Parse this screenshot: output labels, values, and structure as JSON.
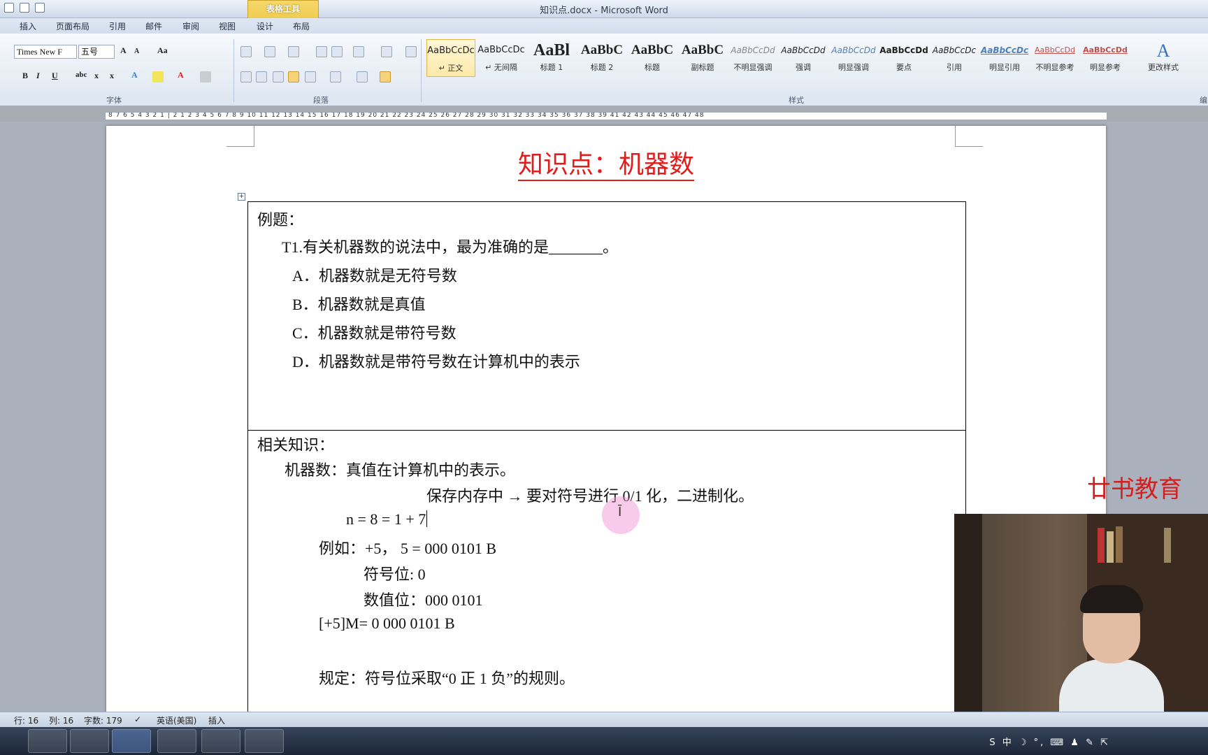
{
  "window": {
    "title": "知识点.docx - Microsoft Word"
  },
  "context_tab": "表格工具",
  "tabs": [
    "插入",
    "页面布局",
    "引用",
    "邮件",
    "审阅",
    "视图",
    "设计",
    "布局"
  ],
  "font": {
    "name": "Times New F",
    "size": "五号"
  },
  "groups": {
    "font": "字体",
    "paragraph": "段落",
    "styles": "样式",
    "edit": "编"
  },
  "styles": [
    {
      "preview": "AaBbCcDc",
      "name": "↵ 正文"
    },
    {
      "preview": "AaBbCcDc",
      "name": "↵ 无间隔"
    },
    {
      "preview": "AaBl",
      "name": "标题 1"
    },
    {
      "preview": "AaBbC",
      "name": "标题 2"
    },
    {
      "preview": "AaBbC",
      "name": "标题"
    },
    {
      "preview": "AaBbC",
      "name": "副标题"
    },
    {
      "preview": "AaBbCcDd",
      "name": "不明显强调"
    },
    {
      "preview": "AaBbCcDd",
      "name": "强调"
    },
    {
      "preview": "AaBbCcDd",
      "name": "明显强调"
    },
    {
      "preview": "AaBbCcDd",
      "name": "要点"
    },
    {
      "preview": "AaBbCcDc",
      "name": "引用"
    },
    {
      "preview": "AaBbCcDc",
      "name": "明显引用"
    },
    {
      "preview": "AaBbCcDd",
      "name": "不明显参考"
    },
    {
      "preview": "AaBbCcDd",
      "name": "明显参考"
    }
  ],
  "change_styles": "更改样式",
  "ruler": "8 7 6 5 4 3 2 1 | 2 1 2 3 4 5 6 7 8 9 10 11 12 13 14 15 16 17 18 19 20 21 22 23 24 25 26 27 28 29 30 31 32 33 34 35 36 37 38 39 41 42 43 44 45 46 47 48",
  "document": {
    "title": "知识点：机器数",
    "example_label": "例题：",
    "question": "T1.有关机器数的说法中，最为准确的是_______。",
    "options": [
      "A．机器数就是无符号数",
      "B．机器数就是真值",
      "C．机器数就是带符号数",
      "D．机器数就是带符号数在计算机中的表示"
    ],
    "knowledge_label": "相关知识：",
    "lines": [
      "机器数：真值在计算机中的表示。",
      "保存内存中  →  要对符号进行 0/1 化，二进制化。",
      "n = 8 = 1 + 7",
      "例如：+5，    5 = 000 0101 B",
      "符号位: 0",
      "数值位：000 0101",
      "[+5]M= 0 000 0101 B",
      "规定：符号位采取“0 正 1 负”的规则。"
    ]
  },
  "status": {
    "row": "行: 16",
    "col": "列: 16",
    "words": "字数: 179",
    "lang": "英语(美国)",
    "mode": "插入"
  },
  "brand": "廿书教育",
  "tray": "S 中 ☽ °, ⌨ ♟ ✎ ⇱"
}
